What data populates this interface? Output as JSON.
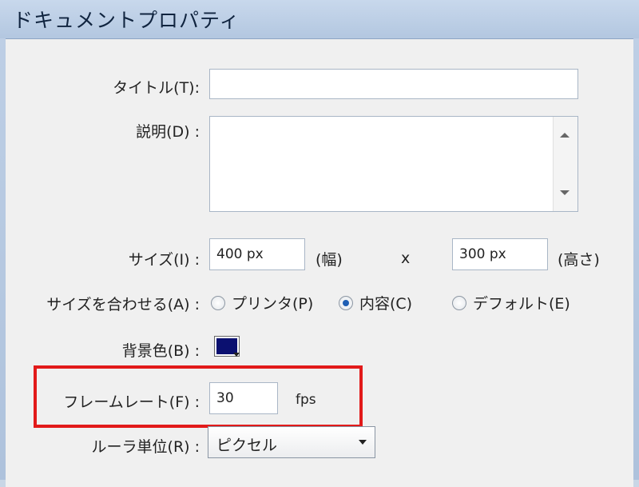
{
  "window": {
    "title": "ドキュメントプロパティ"
  },
  "form": {
    "title_label": "タイトル(T):",
    "title_value": "",
    "description_label": "説明(D) :",
    "description_value": "",
    "size_label": "サイズ(I) :",
    "width_value": "400 px",
    "width_unit": "(幅)",
    "times": "x",
    "height_value": "300 px",
    "height_unit": "(高さ)",
    "fit_label": "サイズを合わせる(A) :",
    "fit_options": [
      {
        "label": "プリンタ(P)",
        "selected": false
      },
      {
        "label": "内容(C)",
        "selected": true
      },
      {
        "label": "デフォルト(E)",
        "selected": false
      }
    ],
    "bg_label": "背景色(B) :",
    "bg_color": "#0b1070",
    "framerate_label": "フレームレート(F) :",
    "framerate_value": "30",
    "framerate_unit": "fps",
    "ruler_label": "ルーラ単位(R) :",
    "ruler_value": "ピクセル"
  },
  "colors": {
    "highlight": "#e21a1a",
    "radio_selected": "#1f5fb4"
  }
}
